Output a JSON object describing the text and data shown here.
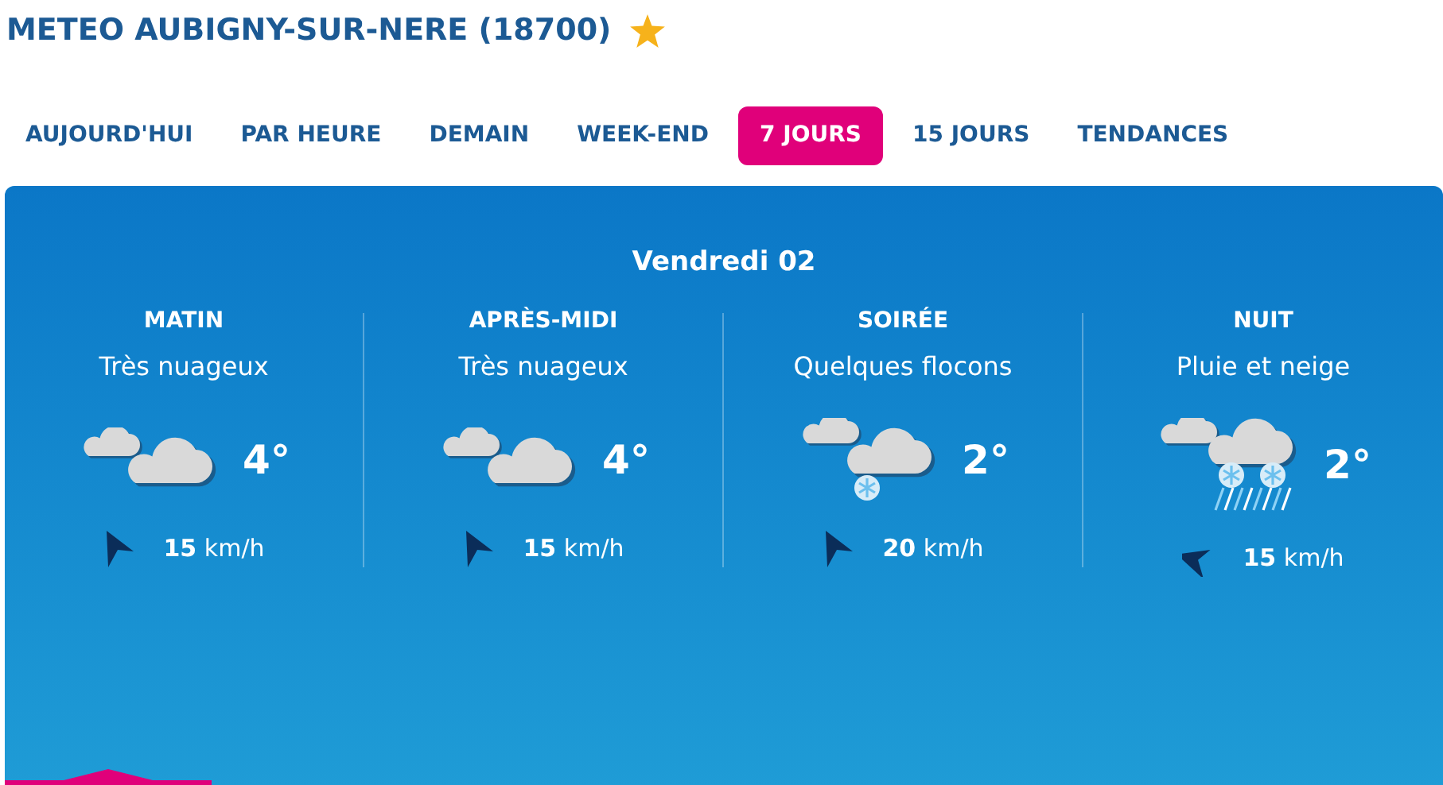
{
  "title": "METEO AUBIGNY-SUR-NERE (18700)",
  "favorite": true,
  "tabs": [
    {
      "label": "AUJOURD'HUI",
      "selected": false
    },
    {
      "label": "PAR HEURE",
      "selected": false
    },
    {
      "label": "DEMAIN",
      "selected": false
    },
    {
      "label": "WEEK-END",
      "selected": false
    },
    {
      "label": "7 JOURS",
      "selected": true
    },
    {
      "label": "15 JOURS",
      "selected": false
    },
    {
      "label": "TENDANCES",
      "selected": false
    }
  ],
  "day": "Vendredi 02",
  "periods": [
    {
      "name": "MATIN",
      "condition": "Très nuageux",
      "kind": "cloudy",
      "temperature": "4°",
      "wind": {
        "speed": "15",
        "unit": "km/h",
        "kind": "west"
      }
    },
    {
      "name": "APRÈS-MIDI",
      "condition": "Très nuageux",
      "kind": "cloudy",
      "temperature": "4°",
      "wind": {
        "speed": "15",
        "unit": "km/h",
        "kind": "west"
      }
    },
    {
      "name": "SOIRÉE",
      "condition": "Quelques flocons",
      "kind": "snow",
      "temperature": "2°",
      "wind": {
        "speed": "20",
        "unit": "km/h",
        "kind": "west"
      }
    },
    {
      "name": "NUIT",
      "condition": "Pluie et neige",
      "kind": "rain-snow",
      "temperature": "2°",
      "wind": {
        "speed": "15",
        "unit": "km/h",
        "kind": "southwest"
      }
    }
  ]
}
